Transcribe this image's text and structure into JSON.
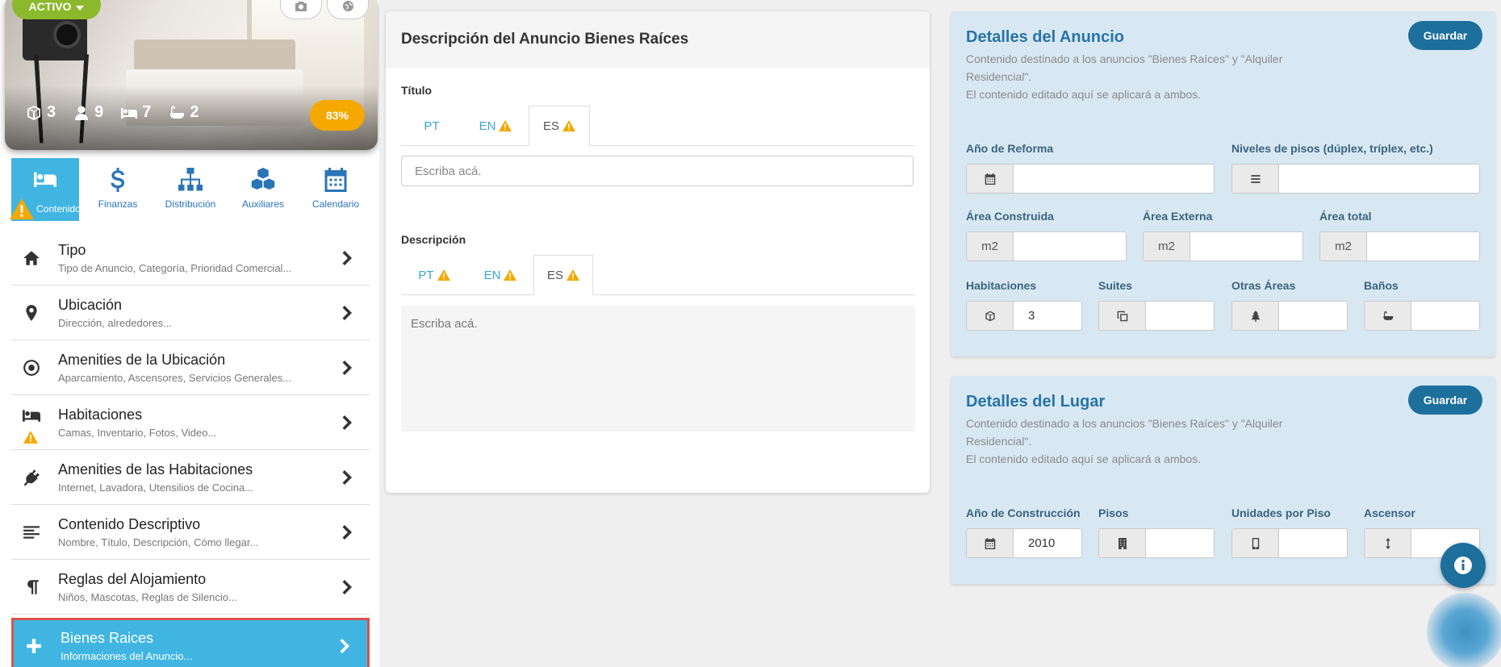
{
  "photo": {
    "status": "ACTIVO",
    "stats": {
      "bedrooms": "3",
      "guests": "9",
      "beds": "7",
      "baths": "2"
    },
    "completion": "83%"
  },
  "nav_tabs": [
    {
      "label": "Contenido",
      "icon": "bed-icon",
      "active": true,
      "warning": true
    },
    {
      "label": "Finanzas",
      "icon": "dollar-icon",
      "active": false
    },
    {
      "label": "Distribución",
      "icon": "sitemap-icon",
      "active": false
    },
    {
      "label": "Auxiliares",
      "icon": "cubes-icon",
      "active": false
    },
    {
      "label": "Calendario",
      "icon": "calendar-icon",
      "active": false
    }
  ],
  "menu": [
    {
      "title": "Tipo",
      "subtitle": "Tipo de Anuncio, Categoría, Prioridad Comercial...",
      "icon": "home-icon"
    },
    {
      "title": "Ubicación",
      "subtitle": "Dirección, alrededores...",
      "icon": "map-pin-icon"
    },
    {
      "title": "Amenities de la Ubicación",
      "subtitle": "Aparcamiento, Ascensores, Servicios Generales...",
      "icon": "dot-circle-icon"
    },
    {
      "title": "Habitaciones",
      "subtitle": "Camas, Inventario, Fotos, Video...",
      "icon": "bed-icon",
      "warning": true
    },
    {
      "title": "Amenities de las Habitaciones",
      "subtitle": "Internet, Lavadora, Utensilios de Cocina...",
      "icon": "plug-icon"
    },
    {
      "title": "Contenido Descriptivo",
      "subtitle": "Nombre, Título, Descripción, Cómo llegar...",
      "icon": "align-left-icon"
    },
    {
      "title": "Reglas del Alojamiento",
      "subtitle": "Niños, Mascotas, Reglas de Silencio...",
      "icon": "paragraph-icon"
    },
    {
      "title": "Bienes Raices",
      "subtitle": "Informaciones del Anuncio...",
      "icon": "plus-icon",
      "selected": true
    }
  ],
  "description_card": {
    "heading": "Descripción del Anuncio Bienes Raíces",
    "title_label": "Título",
    "title_tabs": [
      {
        "label": "PT",
        "warning": false,
        "active": false
      },
      {
        "label": "EN",
        "warning": true,
        "active": false
      },
      {
        "label": "ES",
        "warning": true,
        "active": true
      }
    ],
    "title_placeholder": "Escriba acá.",
    "description_label": "Descripción",
    "description_tabs": [
      {
        "label": "PT",
        "warning": true,
        "active": false
      },
      {
        "label": "EN",
        "warning": true,
        "active": false
      },
      {
        "label": "ES",
        "warning": true,
        "active": true
      }
    ],
    "description_placeholder": "Escriba acá."
  },
  "listing_details": {
    "title": "Detalles del Anuncio",
    "desc_line1": "Contenido destinado a los anuncios \"Bienes Raíces\" y \"Alquiler Residencial\".",
    "desc_line2": "El contenido editado aquí se aplicará a ambos.",
    "save": "Guardar",
    "fields": {
      "renovation_year": {
        "label": "Año de Reforma",
        "value": ""
      },
      "floor_levels": {
        "label": "Niveles de pisos (dúplex, tríplex, etc.)",
        "value": ""
      },
      "built_area": {
        "label": "Área Construida",
        "unit": "m2",
        "value": ""
      },
      "external_area": {
        "label": "Área Externa",
        "unit": "m2",
        "value": ""
      },
      "total_area": {
        "label": "Área total",
        "unit": "m2",
        "value": ""
      },
      "rooms": {
        "label": "Habitaciones",
        "value": "3"
      },
      "suites": {
        "label": "Suites",
        "value": ""
      },
      "other_areas": {
        "label": "Otras Áreas",
        "value": ""
      },
      "bathrooms": {
        "label": "Baños",
        "value": ""
      }
    }
  },
  "place_details": {
    "title": "Detalles del Lugar",
    "desc_line1": "Contenido destinado a los anuncios \"Bienes Raíces\" y \"Alquiler Residencial\".",
    "desc_line2": "El contenido editado aquí se aplicará a ambos.",
    "save": "Guardar",
    "fields": {
      "construction_year": {
        "label": "Año de Construcción",
        "value": "2010"
      },
      "floors": {
        "label": "Pisos",
        "value": ""
      },
      "units_per_floor": {
        "label": "Unidades por Piso",
        "value": ""
      },
      "elevator": {
        "label": "Ascensor",
        "value": ""
      }
    }
  },
  "colors": {
    "accent": "#41b5e2",
    "primary_dark": "#1d6f9c",
    "warning": "#f5a800",
    "active_green": "#8cb92b",
    "selected_border": "#d9534f",
    "card_blue": "#d8e8f3"
  }
}
